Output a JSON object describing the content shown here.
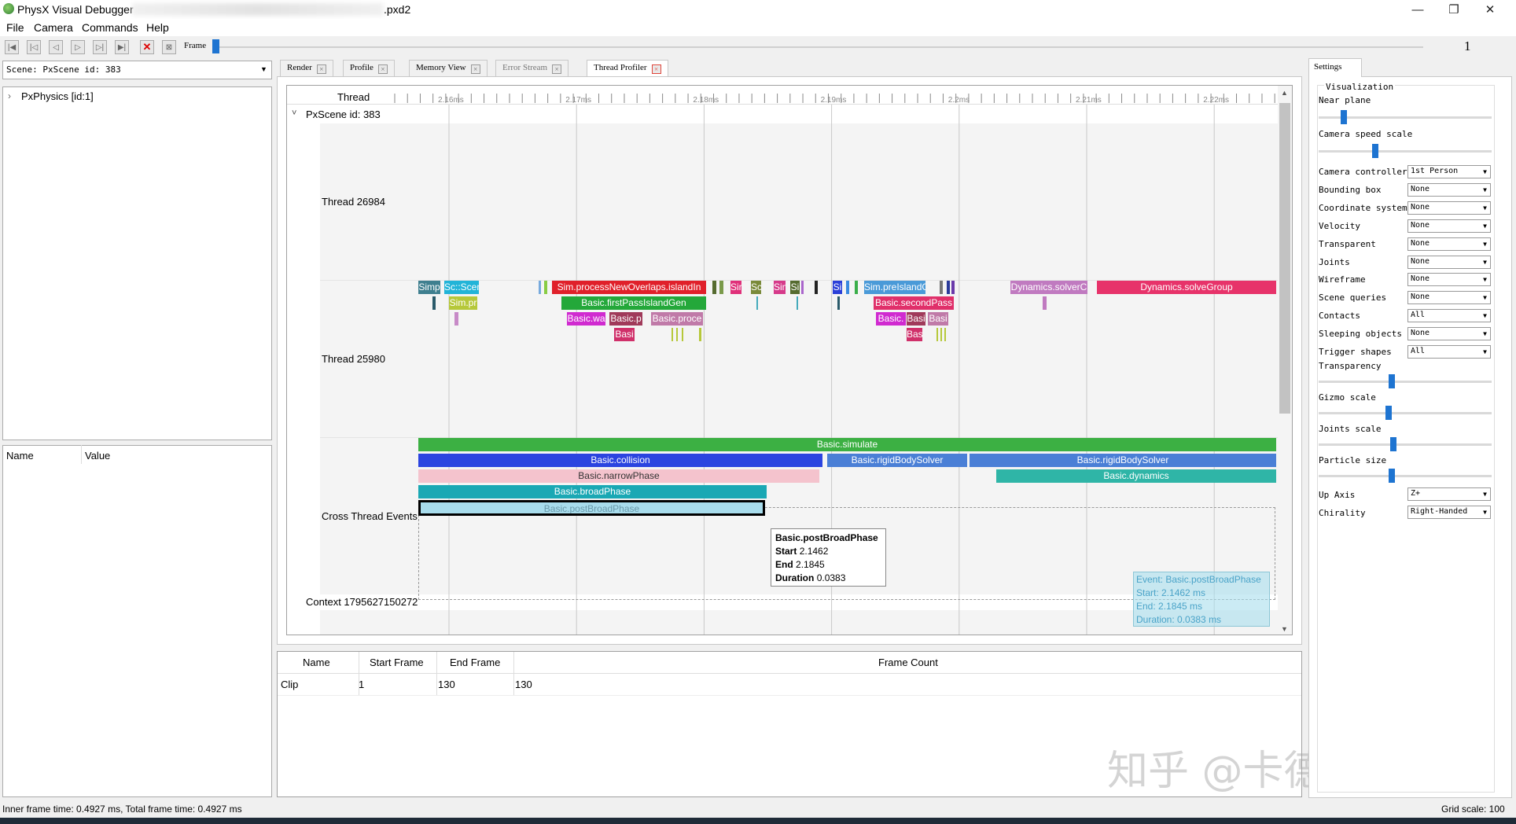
{
  "window": {
    "title_left": "PhysX Visual Debugger",
    "title_right": ".pxd2",
    "minimize": "—",
    "maximize": "❐",
    "close": "✕"
  },
  "menu": [
    "File",
    "Camera",
    "Commands",
    "Help"
  ],
  "toolbar": {
    "frame_label": "Frame",
    "frame_number": "1",
    "frame_position": 0.0
  },
  "scene_select": "Scene: PxScene id: 383",
  "tree": {
    "expander": "›",
    "item": "PxPhysics [id:1]"
  },
  "properties": {
    "name_header": "Name",
    "value_header": "Value"
  },
  "tabs": [
    {
      "label": "Render",
      "close": "×"
    },
    {
      "label": "Profile",
      "close": "×"
    },
    {
      "label": "Memory View",
      "close": "×"
    },
    {
      "label": "Error Stream",
      "close": "×"
    },
    {
      "label": "Thread Profiler",
      "close": "×"
    }
  ],
  "profiler": {
    "thread_header": "Thread",
    "time_ticks": [
      "2.16ms",
      "2.17ms",
      "2.18ms",
      "2.19ms",
      "2.2ms",
      "2.21ms",
      "2.22ms"
    ],
    "scene_label": "PxScene id: 383",
    "collapse_glyph": "˅",
    "rows": [
      "Thread 26984",
      "Thread 25980",
      "Cross Thread Events"
    ],
    "context_label": "Context 1795627150272",
    "thread_25980_labels": {
      "simp": "Simp",
      "scscene": "Sc::Scen",
      "simpr": "Sim.pr",
      "processNewOverlaps": "Sim.processNewOverlaps.islandIn",
      "sir1": "Sir",
      "sc": "Sc",
      "sin": "Sin",
      "si": "Si",
      "si2": "Si",
      "preIsland": "Sim.preIslandGen.is",
      "dynSolver": "Dynamics.solverC",
      "solveGroup": "Dynamics.solveGroup",
      "firstPass": "Basic.firstPassIslandGen",
      "secondPass": "Basic.secondPass",
      "wa": "Basic.wa",
      "bp": "Basic.p",
      "proce": "Basic.proce",
      "basi": "Basi",
      "basi2": "Basic.",
      "basi3": "Basi",
      "basi4": "Basi",
      "bas": "Bas"
    },
    "cross_events": {
      "simulate": "Basic.simulate",
      "collision": "Basic.collision",
      "rigidBodySolver1": "Basic.rigidBodySolver",
      "rigidBodySolver2": "Basic.rigidBodySolver",
      "narrowPhase": "Basic.narrowPhase",
      "dynamics": "Basic.dynamics",
      "broadPhase": "Basic.broadPhase",
      "postBroadPhase": "Basic.postBroadPhase"
    },
    "tooltip": {
      "title": "Basic.postBroadPhase",
      "start_label": "Start",
      "start": "2.1462",
      "end_label": "End",
      "end": "2.1845",
      "duration_label": "Duration",
      "duration": "0.0383"
    },
    "event_info": {
      "event": "Event: Basic.postBroadPhase",
      "start": "Start: 2.1462 ms",
      "end": "End: 2.1845 ms",
      "duration": "Duration: 0.0383 ms"
    },
    "scroll_up": "▲",
    "scroll_down": "▼"
  },
  "clip_table": {
    "headers": [
      "Name",
      "Start Frame",
      "End Frame",
      "Frame Count"
    ],
    "row": [
      "Clip",
      "1",
      "130",
      "130"
    ]
  },
  "settings": {
    "tab": "Settings",
    "visualization": "Visualization",
    "near_plane": "Near plane",
    "camera_speed": "Camera speed scale",
    "combos": [
      {
        "label": "Camera controller",
        "value": "1st Person"
      },
      {
        "label": "Bounding box",
        "value": "None"
      },
      {
        "label": "Coordinate system",
        "value": "None"
      },
      {
        "label": "Velocity",
        "value": "None"
      },
      {
        "label": "Transparent",
        "value": "None"
      },
      {
        "label": "Joints",
        "value": "None"
      },
      {
        "label": "Wireframe",
        "value": "None"
      },
      {
        "label": "Scene queries",
        "value": "None"
      },
      {
        "label": "Contacts",
        "value": "All"
      },
      {
        "label": "Sleeping objects",
        "value": "None"
      },
      {
        "label": "Trigger shapes",
        "value": "All"
      }
    ],
    "transparency": "Transparency",
    "gizmo_scale": "Gizmo scale",
    "joints_scale": "Joints scale",
    "particle_size": "Particle size",
    "up_axis_label": "Up Axis",
    "up_axis": "Z+",
    "chirality_label": "Chirality",
    "chirality": "Right-Handed",
    "slider_levels": {
      "near_plane": 0.13,
      "camera_speed": 0.32,
      "transparency": 0.42,
      "gizmo": 0.4,
      "joints": 0.43,
      "particle": 0.42
    }
  },
  "status": {
    "left": "Inner frame time: 0.4927 ms, Total frame time: 0.4927 ms",
    "right": "Grid scale: 100"
  },
  "watermark": "知乎 @卡德卡斯基",
  "colors": {
    "accent": "#1e74d1",
    "simulate": "#3cb043",
    "collision": "#2b44e0",
    "rigidBodySolver": "#4a7fd6",
    "narrowPhase": "#f4c3cd",
    "dynamics": "#2fb5a7",
    "broadPhase": "#1aa8b4",
    "postBroadPhase": "#a8dcec",
    "solveGroup": "#e7336a"
  }
}
